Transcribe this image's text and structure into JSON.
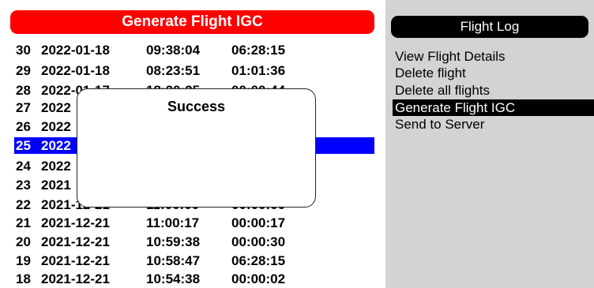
{
  "header": {
    "title": "Generate Flight IGC",
    "color": "#ff0000"
  },
  "flights": [
    {
      "id": "30",
      "date": "2022-01-18",
      "time": "09:38:04",
      "duration": "06:28:15"
    },
    {
      "id": "29",
      "date": "2022-01-18",
      "time": "08:23:51",
      "duration": "01:01:36"
    },
    {
      "id": "28",
      "date": "2022-01-17",
      "time": "18:20:25",
      "duration": "00:00:44"
    },
    {
      "id": "27",
      "date": "2022",
      "time": "",
      "duration": ""
    },
    {
      "id": "26",
      "date": "2022",
      "time": "",
      "duration": ""
    },
    {
      "id": "25",
      "date": "2022",
      "time": "",
      "duration": ""
    },
    {
      "id": "24",
      "date": "2022",
      "time": "",
      "duration": ""
    },
    {
      "id": "23",
      "date": "2021",
      "time": "",
      "duration": ""
    },
    {
      "id": "22",
      "date": "2021-12-21",
      "time": "11:00:00",
      "duration": "00:00:00"
    },
    {
      "id": "21",
      "date": "2021-12-21",
      "time": "11:00:17",
      "duration": "00:00:17"
    },
    {
      "id": "20",
      "date": "2021-12-21",
      "time": "10:59:38",
      "duration": "00:00:30"
    },
    {
      "id": "19",
      "date": "2021-12-21",
      "time": "10:58:47",
      "duration": "06:28:15"
    },
    {
      "id": "18",
      "date": "2021-12-21",
      "time": "10:54:38",
      "duration": "00:00:02"
    }
  ],
  "selected_flight": "25",
  "dialog": {
    "title": "Success"
  },
  "menu": {
    "title": "Flight Log",
    "items": [
      {
        "label": "View Flight Details",
        "active": false
      },
      {
        "label": "Delete flight",
        "active": false
      },
      {
        "label": "Delete all flights",
        "active": false
      },
      {
        "label": "Generate Flight IGC",
        "active": true
      },
      {
        "label": "Send to Server",
        "active": false
      }
    ]
  },
  "colors": {
    "selection": "#0000ff",
    "menu_panel": "#d3d3d3",
    "menu_active": "#000000"
  }
}
